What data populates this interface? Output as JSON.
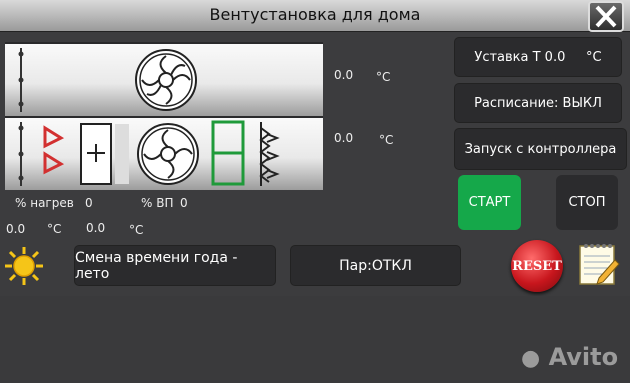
{
  "window": {
    "title": "Вентустановка для дома"
  },
  "readings": {
    "top_temp_value": "0.0",
    "top_temp_unit": "°C",
    "mid_temp_value": "0.0",
    "mid_temp_unit": "°C",
    "heat_label": "% нагрев",
    "heat_value": "0",
    "vp_label": "% ВП",
    "vp_value": "0",
    "bottom_temp1_value": "0.0",
    "bottom_temp1_unit": "°C",
    "bottom_temp2_value": "0.0",
    "bottom_temp2_unit": "°C"
  },
  "buttons": {
    "setpoint": "Уставка Т 0.0     °C",
    "schedule": "Расписание: ВЫКЛ",
    "controller_start": "Запуск с контроллера",
    "start": "СТАРТ",
    "stop": "СТОП",
    "season": "Смена времени года - лето",
    "steam": "Пар:ОТКЛ",
    "reset": "RESET"
  },
  "watermark": "Avito",
  "colors": {
    "background": "#3c3c3e",
    "start_green": "#15a84a",
    "reset_red": "#c8161d",
    "sun_yellow": "#f5c518",
    "heater_red": "#d23030",
    "filter_green": "#1f9a3a"
  },
  "icons": [
    "close-icon",
    "sun-icon",
    "notepad-icon",
    "fan-icon",
    "heater-icon",
    "filter-icon"
  ]
}
